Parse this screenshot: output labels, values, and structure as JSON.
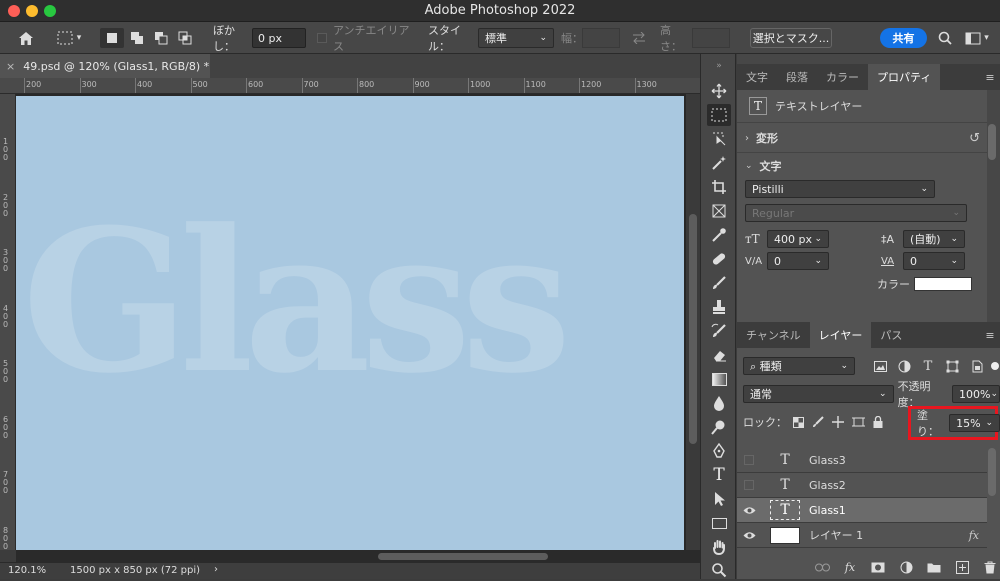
{
  "app": {
    "title": "Adobe Photoshop 2022"
  },
  "options_bar": {
    "feather_label": "ぼかし：",
    "feather_value": "0 px",
    "antialias_label": "アンチエイリアス",
    "style_label": "スタイル：",
    "style_value": "標準",
    "width_label": "幅：",
    "height_label": "高さ：",
    "select_mask_label": "選択とマスク...",
    "share_label": "共有"
  },
  "document": {
    "tab_label": "49.psd @ 120% (Glass1, RGB/8) *",
    "canvas_text": "Glass",
    "canvas_color": "#a9c8e0"
  },
  "ruler": {
    "top_ticks": [
      "200",
      "300",
      "400",
      "500",
      "600",
      "700",
      "800",
      "900",
      "1000",
      "1100",
      "1200",
      "1300"
    ],
    "left_ticks": [
      "100",
      "200",
      "300",
      "400",
      "500",
      "600",
      "700",
      "800"
    ]
  },
  "status": {
    "zoom": "120.1%",
    "doc_info": "1500 px x 850 px (72 ppi)",
    "arrow": "›"
  },
  "props_panel": {
    "tabs": [
      "文字",
      "段落",
      "カラー",
      "プロパティ"
    ],
    "active_tab": 3,
    "layer_type": "テキストレイヤー",
    "transform_label": "変形",
    "text_section_label": "文字",
    "font_family": "Pistilli",
    "font_style": "Regular",
    "font_size": "400 px",
    "leading": "(自動)",
    "kerning": "0",
    "tracking": "0",
    "color_label": "カラー"
  },
  "layers_panel": {
    "tabs": [
      "チャンネル",
      "レイヤー",
      "パス"
    ],
    "active_tab": 1,
    "filter_kind": "種類",
    "blend_mode": "通常",
    "opacity_label": "不透明度：",
    "opacity_value": "100%",
    "lock_label": "ロック：",
    "fill_label": "塗り：",
    "fill_value": "15%",
    "layers": [
      {
        "name": "Glass3",
        "kind": "text",
        "visible": false,
        "selected": false
      },
      {
        "name": "Glass2",
        "kind": "text",
        "visible": false,
        "selected": false
      },
      {
        "name": "Glass1",
        "kind": "text",
        "visible": true,
        "selected": true
      },
      {
        "name": "レイヤー 1",
        "kind": "image",
        "visible": true,
        "selected": false,
        "fx": "fx"
      }
    ]
  },
  "colors": {
    "accent_blue": "#1473e6",
    "highlight_red": "#e8161f"
  }
}
